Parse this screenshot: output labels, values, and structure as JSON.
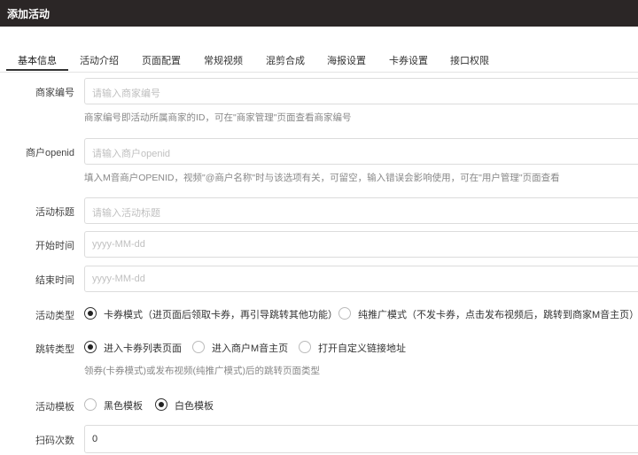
{
  "header": {
    "title": "添加活动"
  },
  "tabs": [
    {
      "label": "基本信息"
    },
    {
      "label": "活动介绍"
    },
    {
      "label": "页面配置"
    },
    {
      "label": "常规视频"
    },
    {
      "label": "混剪合成"
    },
    {
      "label": "海报设置"
    },
    {
      "label": "卡券设置"
    },
    {
      "label": "接口权限"
    }
  ],
  "form": {
    "merchant_id": {
      "label": "商家编号",
      "placeholder": "请输入商家编号",
      "help": "商家编号即活动所属商家的ID，可在\"商家管理\"页面查看商家编号"
    },
    "merchant_openid": {
      "label": "商户openid",
      "placeholder": "请输入商户openid",
      "help": "填入M音商户OPENID，视频\"@商户名称\"时与该选项有关，可留空，输入错误会影响使用，可在\"用户管理\"页面查看"
    },
    "title": {
      "label": "活动标题",
      "placeholder": "请输入活动标题"
    },
    "start_time": {
      "label": "开始时间",
      "placeholder": "yyyy-MM-dd"
    },
    "end_time": {
      "label": "结束时间",
      "placeholder": "yyyy-MM-dd"
    },
    "activity_type": {
      "label": "活动类型",
      "options": [
        {
          "label": "卡券模式（进页面后领取卡券，再引导跳转其他功能）",
          "selected": true
        },
        {
          "label": "纯推广模式（不发卡券，点击发布视频后，跳转到商家M音主页）",
          "selected": false
        }
      ]
    },
    "jump_type": {
      "label": "跳转类型",
      "options": [
        {
          "label": "进入卡券列表页面",
          "selected": true
        },
        {
          "label": "进入商户M音主页",
          "selected": false
        },
        {
          "label": "打开自定义链接地址",
          "selected": false
        }
      ],
      "help": "领券(卡券模式)或发布视频(纯推广模式)后的跳转页面类型"
    },
    "template": {
      "label": "活动模板",
      "options": [
        {
          "label": "黑色模板",
          "selected": false
        },
        {
          "label": "白色模板",
          "selected": true
        }
      ]
    },
    "scan_count": {
      "label": "扫码次数",
      "value": "0"
    }
  }
}
